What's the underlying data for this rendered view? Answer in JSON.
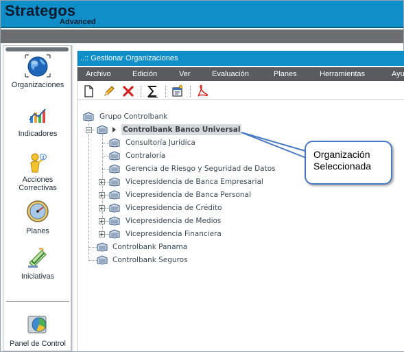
{
  "app": {
    "brand": "Strategos",
    "brand_sub": "Advanced"
  },
  "sidebar": {
    "items": [
      {
        "label": "Organizaciones",
        "icon": "globe-icon"
      },
      {
        "label": "Indicadores",
        "icon": "indicators-chart-icon"
      },
      {
        "label": "Acciones Correctivas",
        "icon": "corrective-actions-icon"
      },
      {
        "label": "Planes",
        "icon": "plans-gauge-icon"
      },
      {
        "label": "Iniciativas",
        "icon": "initiatives-icon"
      },
      {
        "label": "Panel de Control",
        "icon": "control-panel-icon"
      }
    ]
  },
  "panel": {
    "title": "..:: Gestionar Organizaciones",
    "menu": [
      "Archivo",
      "Edición",
      "Ver",
      "Evaluación",
      "Planes",
      "Herramientas",
      "Ayu"
    ],
    "toolbar": [
      {
        "name": "new-document-icon"
      },
      {
        "name": "edit-pencil-icon"
      },
      {
        "name": "delete-x-icon"
      },
      {
        "name": "sigma-calculate-icon"
      },
      {
        "name": "properties-icon"
      },
      {
        "name": "pdf-export-icon"
      }
    ]
  },
  "tree": {
    "root": "Grupo Controlbank",
    "selected": "Controlbank Banco Universal",
    "children": [
      "Consultoría Jurídica",
      "Contraloría",
      "Gerencia de Riesgo y Seguridad de Datos",
      "Vicepresidencia de Banca Empresarial",
      "Vicepresidencia de Banca Personal",
      "Vicepresidencia de Crédito",
      "Vicepresidencia de Medios",
      "Vicepresidencia Financiera"
    ],
    "siblings": [
      "Controlbank Panama",
      "Controlbank Seguros"
    ]
  },
  "callout": {
    "line1": "Organización",
    "line2": "Seleccionada",
    "border_color": "#4a79c4"
  },
  "colors": {
    "header_blue": "#0f8ec7",
    "menubar_gray": "#595b5e",
    "selected_bg": "#d6d9dc"
  }
}
